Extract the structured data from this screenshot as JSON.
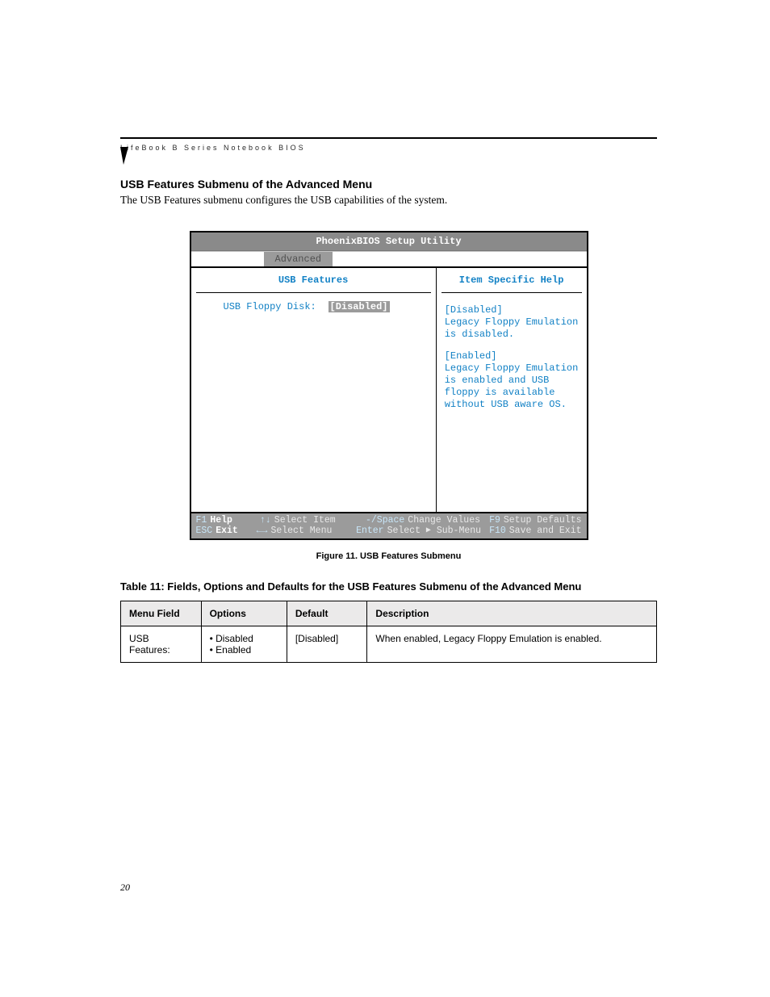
{
  "header": {
    "running_head": "LifeBook B Series Notebook BIOS"
  },
  "section": {
    "title": "USB Features Submenu of the Advanced Menu",
    "description": "The USB Features submenu configures the USB capabilities of the system."
  },
  "bios": {
    "title": "PhoenixBIOS Setup Utility",
    "active_tab": "Advanced",
    "left_title": "USB Features",
    "right_title": "Item Specific Help",
    "field": {
      "label": "USB Floppy Disk:",
      "value": "[Disabled]"
    },
    "help": {
      "disabled_head": "[Disabled]",
      "disabled_body": "Legacy Floppy Emulation is disabled.",
      "enabled_head": "[Enabled]",
      "enabled_body": "Legacy Floppy Emulation is enabled and USB floppy is available without USB aware OS."
    },
    "footer": {
      "f1": "F1",
      "f1_label": "Help",
      "esc": "ESC",
      "esc_label": "Exit",
      "updown": "↑↓",
      "updown_label": "Select Item",
      "leftright": "←→",
      "leftright_label": "Select Menu",
      "minus_space": "-/Space",
      "minus_space_label": "Change Values",
      "enter": "Enter",
      "enter_label_pre": "Select",
      "enter_label_post": "Sub-Menu",
      "f9": "F9",
      "f9_label": "Setup Defaults",
      "f10": "F10",
      "f10_label": "Save and Exit"
    }
  },
  "figure_caption": "Figure 11.  USB Features Submenu",
  "table_title": "Table 11: Fields, Options and Defaults for the USB Features Submenu of the Advanced Menu",
  "table": {
    "headers": [
      "Menu Field",
      "Options",
      "Default",
      "Description"
    ],
    "row": {
      "menu_field": "USB Features:",
      "option1": "Disabled",
      "option2": "Enabled",
      "default": "[Disabled]",
      "description": "When enabled, Legacy Floppy Emulation is enabled."
    }
  },
  "page_number": "20"
}
